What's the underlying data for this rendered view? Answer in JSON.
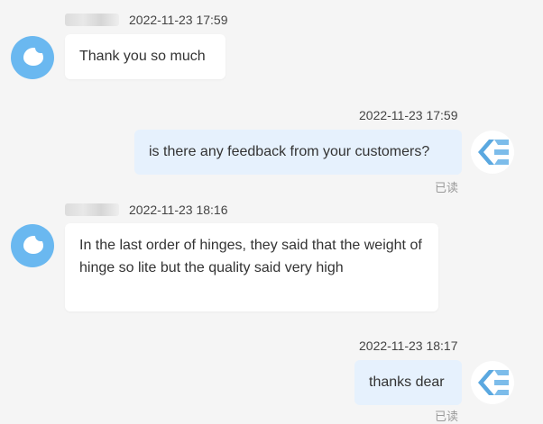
{
  "conversation": {
    "messages": [
      {
        "side": "in",
        "timestamp": "2022-11-23 17:59",
        "text": "Thank you so much"
      },
      {
        "side": "out",
        "timestamp": "2022-11-23 17:59",
        "text": "is there any feedback from your customers?",
        "status": "已读"
      },
      {
        "side": "in",
        "timestamp": "2022-11-23 18:16",
        "text": "In the last order of hinges, they said that the weight of hinge so lite but the quality said very high"
      },
      {
        "side": "out",
        "timestamp": "2022-11-23 18:17",
        "text": "thanks dear",
        "status": "已读"
      }
    ]
  },
  "colors": {
    "background": "#f5f5f5",
    "incoming_bubble": "#ffffff",
    "outgoing_bubble": "#e6f1fd",
    "customer_avatar": "#6ab8f0",
    "agent_logo": "#5aa8e0"
  },
  "icons": {
    "customer_avatar": "chat-bubble-icon",
    "agent_avatar": "e-logo-icon"
  }
}
